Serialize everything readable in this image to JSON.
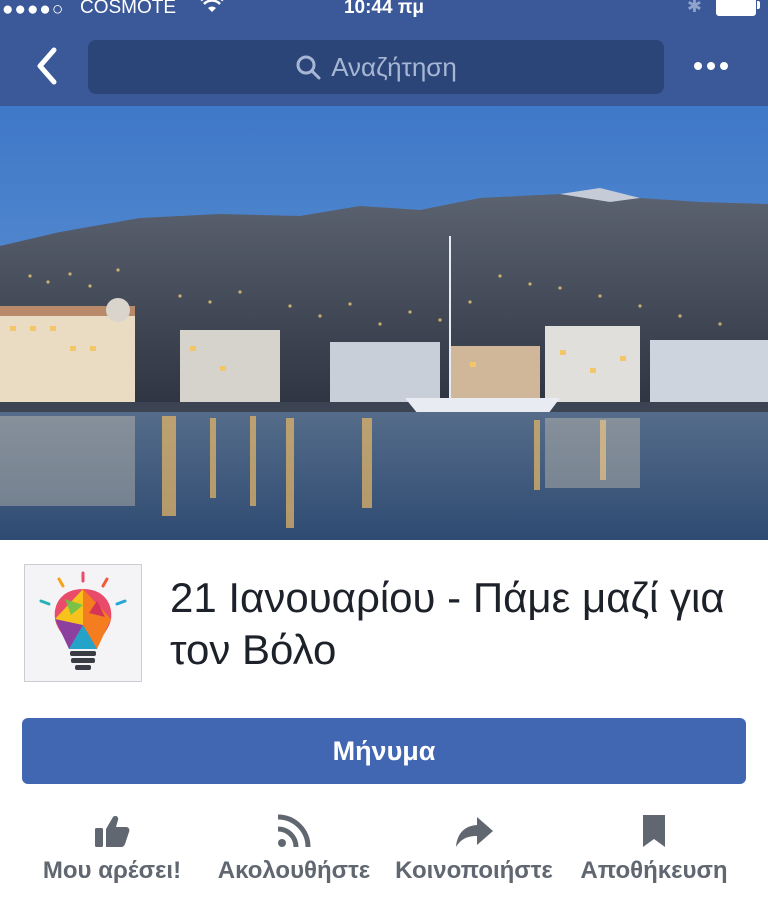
{
  "status_bar": {
    "signal": "●●●●○",
    "carrier": "COSMOTE",
    "time": "10:44 πμ"
  },
  "nav": {
    "search_placeholder": "Αναζήτηση"
  },
  "page": {
    "name": "21 Ιανουαρίου - Πάμε μαζί για τον Βόλο"
  },
  "buttons": {
    "message": "Μήνυμα"
  },
  "actions": [
    {
      "label": "Μου αρέσει!",
      "icon": "thumbs-up-icon"
    },
    {
      "label": "Ακολουθήστε",
      "icon": "rss-follow-icon"
    },
    {
      "label": "Κοινοποιήστε",
      "icon": "share-arrow-icon"
    },
    {
      "label": "Αποθήκευση",
      "icon": "bookmark-icon"
    }
  ],
  "colors": {
    "facebook_blue": "#3b5998",
    "button_blue": "#4267b2",
    "action_gray": "#606770"
  }
}
